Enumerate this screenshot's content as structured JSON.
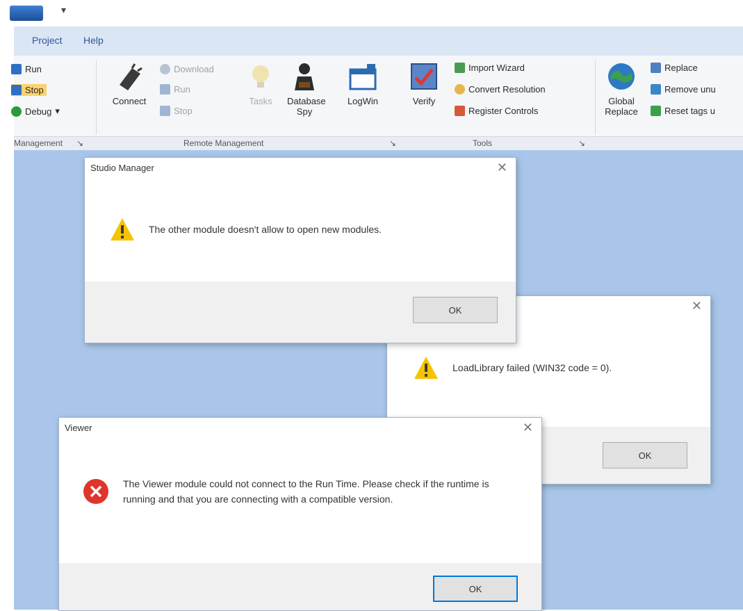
{
  "menu": {
    "project": "Project",
    "help": "Help"
  },
  "ribbon": {
    "management": {
      "run": "Run",
      "stop": "Stop",
      "debug": "Debug"
    },
    "remote": {
      "connect": "Connect",
      "download": "Download",
      "run": "Run",
      "stop": "Stop"
    },
    "tools": {
      "tasks": "Tasks",
      "database_spy": "Database Spy",
      "logwin": "LogWin",
      "verify": "Verify",
      "import_wizard": "Import Wizard",
      "convert_resolution": "Convert Resolution",
      "register_controls": "Register Controls"
    },
    "global": {
      "global_replace": "Global Replace",
      "replace": "Replace",
      "remove_unused": "Remove unu",
      "reset_tags": "Reset tags u"
    },
    "groups": {
      "management": "Management",
      "remote": "Remote Management",
      "tools": "Tools"
    }
  },
  "dialogs": [
    {
      "title": "Studio Manager",
      "message": "The other module doesn't allow to open new modules.",
      "ok": "OK"
    },
    {
      "title": "",
      "message": "LoadLibrary failed (WIN32 code = 0).",
      "ok": "OK"
    },
    {
      "title": "Viewer",
      "message": "The Viewer module could not connect to the Run Time. Please check if the runtime is running and that you are connecting with a compatible version.",
      "ok": "OK"
    }
  ],
  "close_glyph": "✕",
  "colors": {
    "warning": "#f5c400",
    "error": "#e0352b",
    "workspace": "#a9c6ea",
    "ribbon_menu": "#dbe6f5"
  }
}
